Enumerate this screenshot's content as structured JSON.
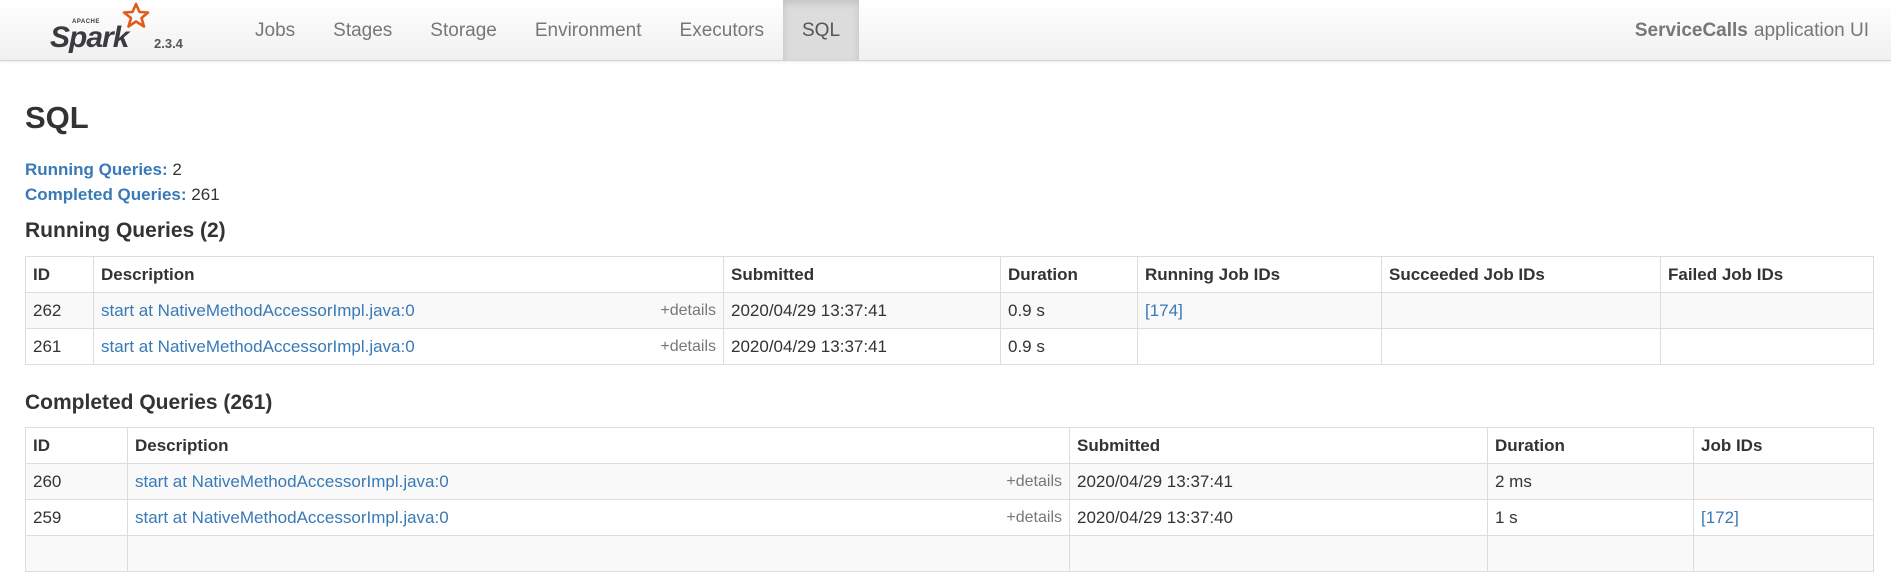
{
  "brand": {
    "logo_alt": "Apache Spark",
    "version": "2.3.4"
  },
  "nav": [
    {
      "label": "Jobs",
      "active": false
    },
    {
      "label": "Stages",
      "active": false
    },
    {
      "label": "Storage",
      "active": false
    },
    {
      "label": "Environment",
      "active": false
    },
    {
      "label": "Executors",
      "active": false
    },
    {
      "label": "SQL",
      "active": true
    }
  ],
  "app": {
    "name": "ServiceCalls",
    "suffix": "application UI"
  },
  "page_title": "SQL",
  "summary": {
    "running_label": "Running Queries:",
    "running_count": "2",
    "completed_label": "Completed Queries:",
    "completed_count": "261"
  },
  "running": {
    "title": "Running Queries (2)",
    "headers": [
      "ID",
      "Description",
      "Submitted",
      "Duration",
      "Running Job IDs",
      "Succeeded Job IDs",
      "Failed Job IDs"
    ],
    "rows": [
      {
        "id": "262",
        "description": "start at NativeMethodAccessorImpl.java:0",
        "details": "+details",
        "submitted": "2020/04/29 13:37:41",
        "duration": "0.9 s",
        "running_job_ids": "[174]",
        "succeeded_job_ids": "",
        "failed_job_ids": ""
      },
      {
        "id": "261",
        "description": "start at NativeMethodAccessorImpl.java:0",
        "details": "+details",
        "submitted": "2020/04/29 13:37:41",
        "duration": "0.9 s",
        "running_job_ids": "",
        "succeeded_job_ids": "",
        "failed_job_ids": ""
      }
    ]
  },
  "completed": {
    "title": "Completed Queries (261)",
    "headers": [
      "ID",
      "Description",
      "Submitted",
      "Duration",
      "Job IDs"
    ],
    "rows": [
      {
        "id": "260",
        "description": "start at NativeMethodAccessorImpl.java:0",
        "details": "+details",
        "submitted": "2020/04/29 13:37:41",
        "duration": "2 ms",
        "job_ids": ""
      },
      {
        "id": "259",
        "description": "start at NativeMethodAccessorImpl.java:0",
        "details": "+details",
        "submitted": "2020/04/29 13:37:40",
        "duration": "1 s",
        "job_ids": "[172]"
      }
    ]
  },
  "colors": {
    "link": "#3879b7",
    "logo_star": "#e25a1c",
    "logo_text": "#3c3a3e"
  }
}
